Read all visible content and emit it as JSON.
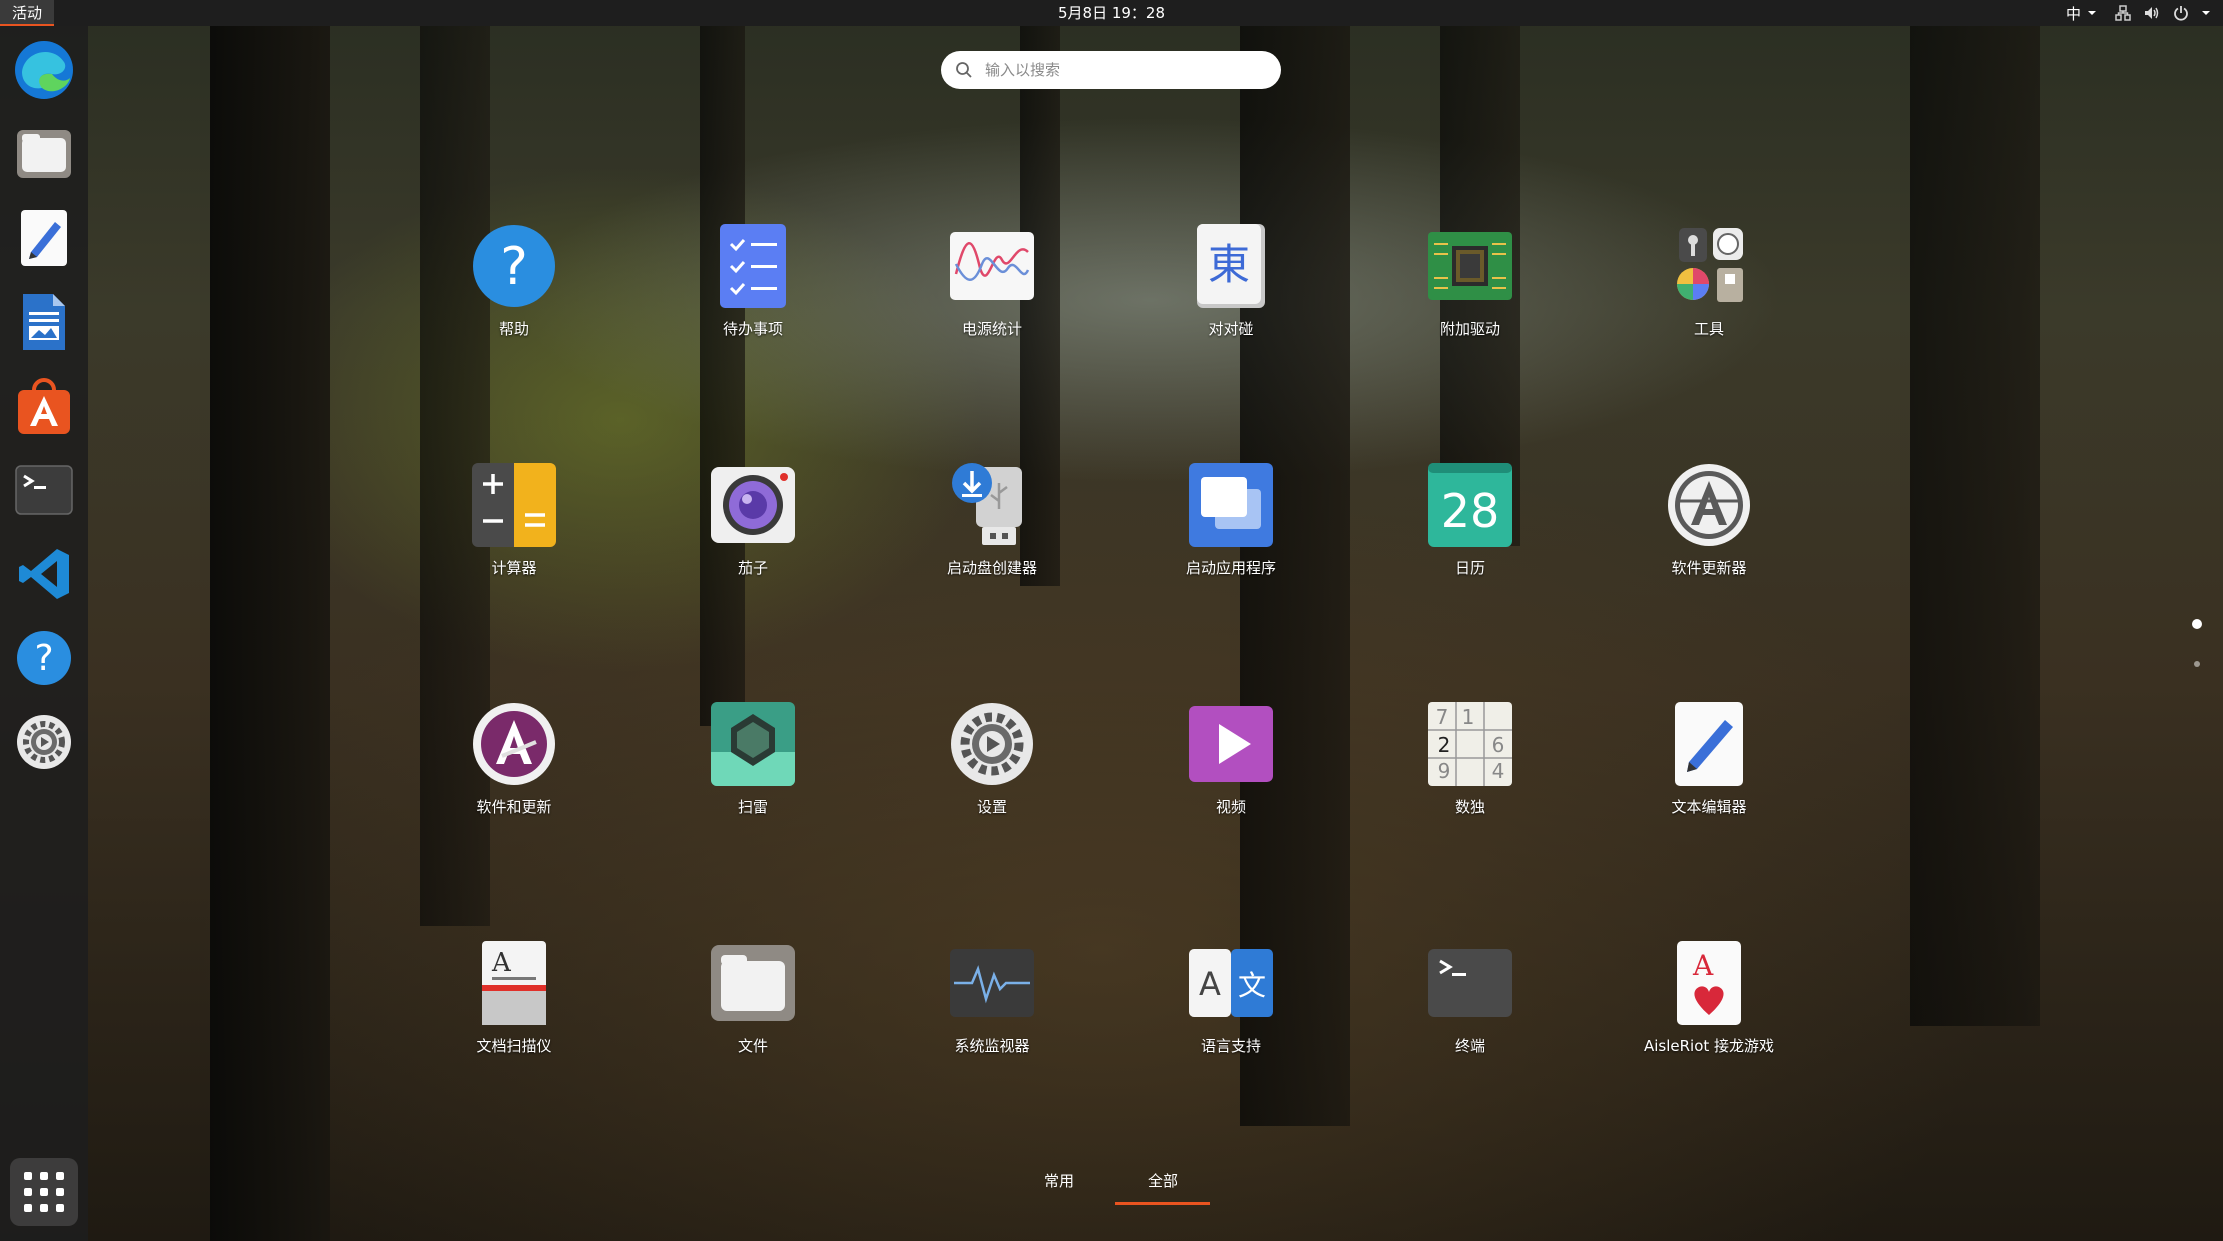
{
  "topbar": {
    "activities": "活动",
    "clock": "5月8日  19：28",
    "input_method": "中",
    "tray_icons": [
      "network-icon",
      "volume-icon",
      "power-icon",
      "chevron-down-icon"
    ]
  },
  "dock": {
    "items": [
      {
        "name": "Microsoft Edge",
        "icon": "edge-icon"
      },
      {
        "name": "文件",
        "icon": "files-icon"
      },
      {
        "name": "文本编辑器",
        "icon": "text-editor-icon"
      },
      {
        "name": "LibreOffice Writer",
        "icon": "writer-icon"
      },
      {
        "name": "Ubuntu Software",
        "icon": "software-center-icon"
      },
      {
        "name": "终端",
        "icon": "terminal-icon"
      },
      {
        "name": "Visual Studio Code",
        "icon": "vscode-icon"
      },
      {
        "name": "帮助",
        "icon": "help-icon"
      },
      {
        "name": "设置",
        "icon": "settings-icon"
      }
    ],
    "show_apps_icon": "app-grid-icon"
  },
  "search": {
    "placeholder": "输入以搜索",
    "value": ""
  },
  "apps": [
    {
      "label": "帮助",
      "icon": "help-icon"
    },
    {
      "label": "待办事项",
      "icon": "todo-icon"
    },
    {
      "label": "电源统计",
      "icon": "power-statistics-icon"
    },
    {
      "label": "对对碰",
      "icon": "mahjongg-icon",
      "glyph": "東"
    },
    {
      "label": "附加驱动",
      "icon": "chip-icon"
    },
    {
      "label": "工具",
      "icon": "utilities-folder-icon"
    },
    {
      "label": "计算器",
      "icon": "calculator-icon"
    },
    {
      "label": "茄子",
      "icon": "cheese-icon"
    },
    {
      "label": "启动盘创建器",
      "icon": "usb-creator-icon"
    },
    {
      "label": "启动应用程序",
      "icon": "startup-apps-icon"
    },
    {
      "label": "日历",
      "icon": "calendar-icon",
      "glyph": "28"
    },
    {
      "label": "软件更新器",
      "icon": "software-updater-icon"
    },
    {
      "label": "软件和更新",
      "icon": "software-properties-icon"
    },
    {
      "label": "扫雷",
      "icon": "mines-icon"
    },
    {
      "label": "设置",
      "icon": "settings-icon"
    },
    {
      "label": "视频",
      "icon": "videos-icon"
    },
    {
      "label": "数独",
      "icon": "sudoku-icon"
    },
    {
      "label": "文本编辑器",
      "icon": "text-editor-icon"
    },
    {
      "label": "文档扫描仪",
      "icon": "document-scanner-icon"
    },
    {
      "label": "文件",
      "icon": "files-icon"
    },
    {
      "label": "系统监视器",
      "icon": "system-monitor-icon"
    },
    {
      "label": "语言支持",
      "icon": "language-support-icon"
    },
    {
      "label": "终端",
      "icon": "terminal-icon"
    },
    {
      "label": "AisleRiot 接龙游戏",
      "icon": "aisleriot-icon"
    }
  ],
  "sudoku_digits": [
    "7",
    "1",
    "2",
    "6",
    "9",
    "4"
  ],
  "language_glyphs": [
    "A",
    "文"
  ],
  "pages": {
    "count": 2,
    "current": 1
  },
  "tabs": {
    "frequent": "常用",
    "all": "全部",
    "active": "all"
  },
  "colors": {
    "accent": "#e95420",
    "topbar": "#1e1e1e"
  }
}
